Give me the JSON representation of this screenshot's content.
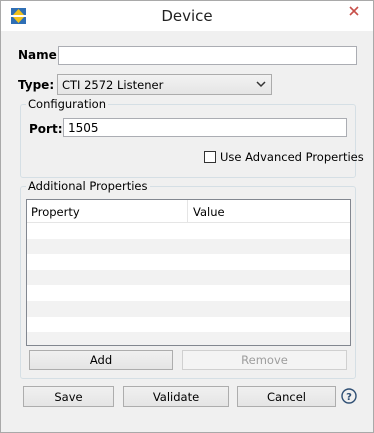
{
  "window": {
    "title": "Device"
  },
  "form": {
    "name_label": "Name:",
    "name_value": "",
    "type_label": "Type:",
    "type_value": "CTI 2572 Listener"
  },
  "configuration": {
    "title": "Configuration",
    "port_label": "Port:",
    "port_value": "1505",
    "advanced_label": "Use Advanced Properties",
    "advanced_checked": false
  },
  "additional": {
    "title": "Additional Properties",
    "columns": [
      "Property",
      "Value"
    ],
    "rows": [],
    "add_label": "Add",
    "remove_label": "Remove"
  },
  "footer": {
    "save_label": "Save",
    "validate_label": "Validate",
    "cancel_label": "Cancel"
  },
  "icons": {
    "app": "app-logo-icon",
    "close": "close-icon",
    "dropdown": "chevron-down-icon",
    "help": "help-icon"
  },
  "colors": {
    "close_button": "#c7504a",
    "icon_yellow": "#f2c21b",
    "icon_blue": "#2f6fb5"
  }
}
